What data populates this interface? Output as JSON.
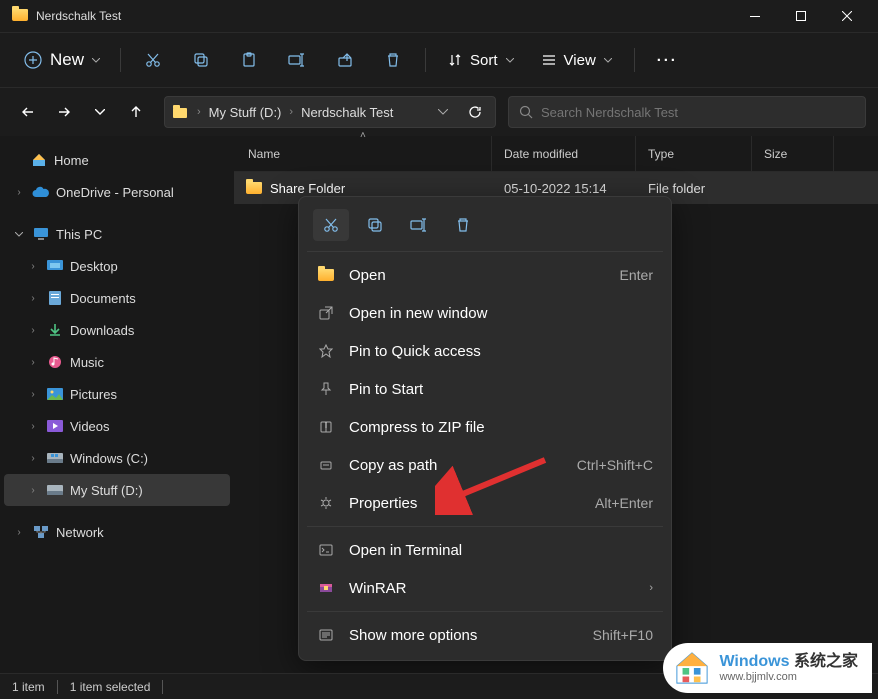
{
  "window": {
    "title": "Nerdschalk Test"
  },
  "toolbar": {
    "new_label": "New",
    "sort_label": "Sort",
    "view_label": "View"
  },
  "address": {
    "seg1": "My Stuff (D:)",
    "seg2": "Nerdschalk Test"
  },
  "search": {
    "placeholder": "Search Nerdschalk Test"
  },
  "sidebar": {
    "home": "Home",
    "onedrive": "OneDrive - Personal",
    "thispc": "This PC",
    "desktop": "Desktop",
    "documents": "Documents",
    "downloads": "Downloads",
    "music": "Music",
    "pictures": "Pictures",
    "videos": "Videos",
    "windowsc": "Windows (C:)",
    "mystuff": "My Stuff (D:)",
    "network": "Network"
  },
  "columns": {
    "name": "Name",
    "date": "Date modified",
    "type": "Type",
    "size": "Size"
  },
  "files": [
    {
      "name": "Share Folder",
      "date": "05-10-2022 15:14",
      "type": "File folder"
    }
  ],
  "context_menu": {
    "open": "Open",
    "open_shortcut": "Enter",
    "open_new_window": "Open in new window",
    "pin_quick": "Pin to Quick access",
    "pin_start": "Pin to Start",
    "compress": "Compress to ZIP file",
    "copy_path": "Copy as path",
    "copy_path_shortcut": "Ctrl+Shift+C",
    "properties": "Properties",
    "properties_shortcut": "Alt+Enter",
    "terminal": "Open in Terminal",
    "winrar": "WinRAR",
    "show_more": "Show more options",
    "show_more_shortcut": "Shift+F10"
  },
  "statusbar": {
    "items": "1 item",
    "selected": "1 item selected"
  },
  "watermark": {
    "brand_win": "Windows",
    "brand_cn": "系统之家",
    "url": "www.bjjmlv.com"
  }
}
